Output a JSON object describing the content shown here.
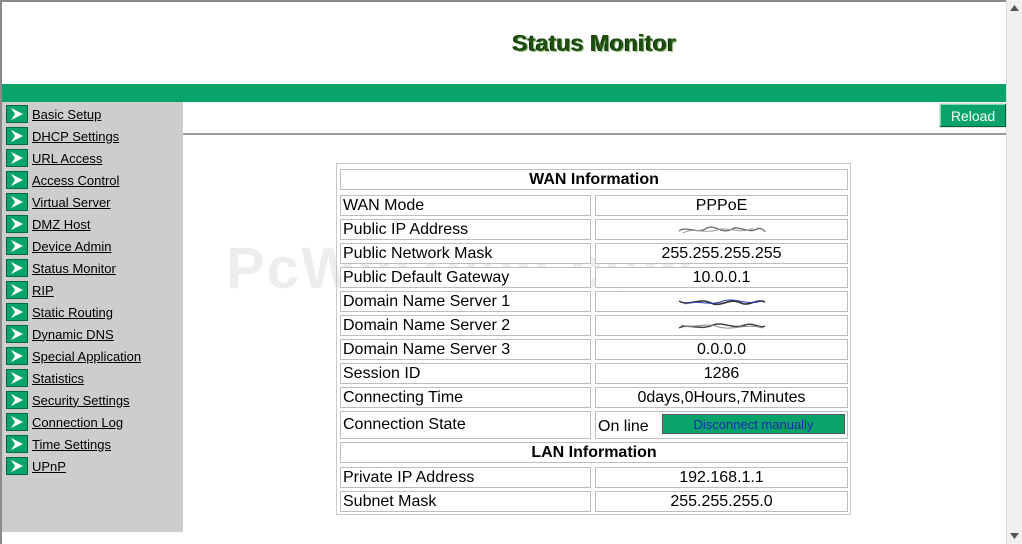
{
  "header": {
    "title": "Status Monitor"
  },
  "toolbar": {
    "reload_label": "Reload"
  },
  "sidebar": {
    "items": [
      {
        "label": "Basic Setup"
      },
      {
        "label": "DHCP Settings"
      },
      {
        "label": "URL Access"
      },
      {
        "label": "Access Control"
      },
      {
        "label": "Virtual Server"
      },
      {
        "label": "DMZ Host"
      },
      {
        "label": "Device Admin"
      },
      {
        "label": "Status Monitor"
      },
      {
        "label": "RIP"
      },
      {
        "label": "Static Routing"
      },
      {
        "label": "Dynamic DNS"
      },
      {
        "label": "Special Application"
      },
      {
        "label": "Statistics"
      },
      {
        "label": "Security Settings"
      },
      {
        "label": "Connection Log"
      },
      {
        "label": "Time Settings"
      },
      {
        "label": "UPnP"
      }
    ]
  },
  "wan": {
    "heading": "WAN Information",
    "rows": [
      {
        "label": "WAN Mode",
        "value": "PPPoE"
      },
      {
        "label": "Public IP Address",
        "value": ""
      },
      {
        "label": "Public Network Mask",
        "value": "255.255.255.255"
      },
      {
        "label": "Public Default Gateway",
        "value": "10.0.0.1"
      },
      {
        "label": "Domain Name Server 1",
        "value": ""
      },
      {
        "label": "Domain Name Server 2",
        "value": ""
      },
      {
        "label": "Domain Name Server 3",
        "value": "0.0.0.0"
      },
      {
        "label": "Session ID",
        "value": "1286"
      },
      {
        "label": "Connecting Time",
        "value": "0days,0Hours,7Minutes"
      }
    ],
    "connection_state": {
      "label": "Connection State",
      "value": "On line",
      "button_label": "Disconnect manually"
    }
  },
  "lan": {
    "heading": "LAN Information",
    "rows": [
      {
        "label": "Private IP Address",
        "value": "192.168.1.1"
      },
      {
        "label": "Subnet Mask",
        "value": "255.255.255.0"
      }
    ]
  },
  "watermark": "PcWinTech.com",
  "colors": {
    "accent": "#0aa36a",
    "sidebar": "#cdcdcd",
    "title": "#1f4f10",
    "button_text": "#1a2ab0"
  },
  "icons": {
    "nav_arrow": "green-arrow-icon",
    "redacted_value": "scribble-redaction"
  }
}
